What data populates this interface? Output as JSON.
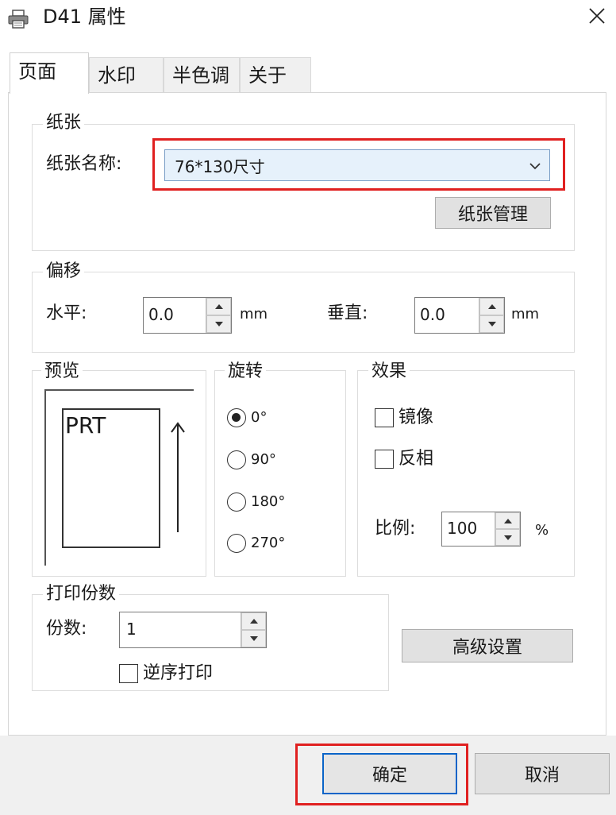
{
  "window": {
    "title": "D41 属性",
    "icon": "printer-icon",
    "close_icon": "close-icon"
  },
  "tabs": [
    {
      "label": "页面",
      "active": true
    },
    {
      "label": "水印",
      "active": false
    },
    {
      "label": "半色调",
      "active": false
    },
    {
      "label": "关于",
      "active": false
    }
  ],
  "paper": {
    "group_title": "纸张",
    "name_label": "纸张名称:",
    "name_value": "76*130尺寸",
    "manage_button": "纸张管理"
  },
  "offset": {
    "group_title": "偏移",
    "horizontal_label": "水平:",
    "horizontal_value": "0.0",
    "vertical_label": "垂直:",
    "vertical_value": "0.0",
    "unit": "mm"
  },
  "preview": {
    "group_title": "预览",
    "text": "PRT"
  },
  "rotation": {
    "group_title": "旋转",
    "options": [
      "0°",
      "90°",
      "180°",
      "270°"
    ],
    "selected_index": 0
  },
  "effects": {
    "group_title": "效果",
    "mirror_label": "镜像",
    "mirror_checked": false,
    "invert_label": "反相",
    "invert_checked": false,
    "scale_label": "比例:",
    "scale_value": "100",
    "scale_unit": "%"
  },
  "copies": {
    "group_title": "打印份数",
    "count_label": "份数:",
    "count_value": "1",
    "reverse_label": "逆序打印",
    "reverse_checked": false
  },
  "advanced_button": "高级设置",
  "footer": {
    "ok": "确定",
    "cancel": "取消"
  },
  "colors": {
    "highlight": "#e02020",
    "accent": "#0a64c8",
    "combo_bg": "#e6f1fb"
  }
}
